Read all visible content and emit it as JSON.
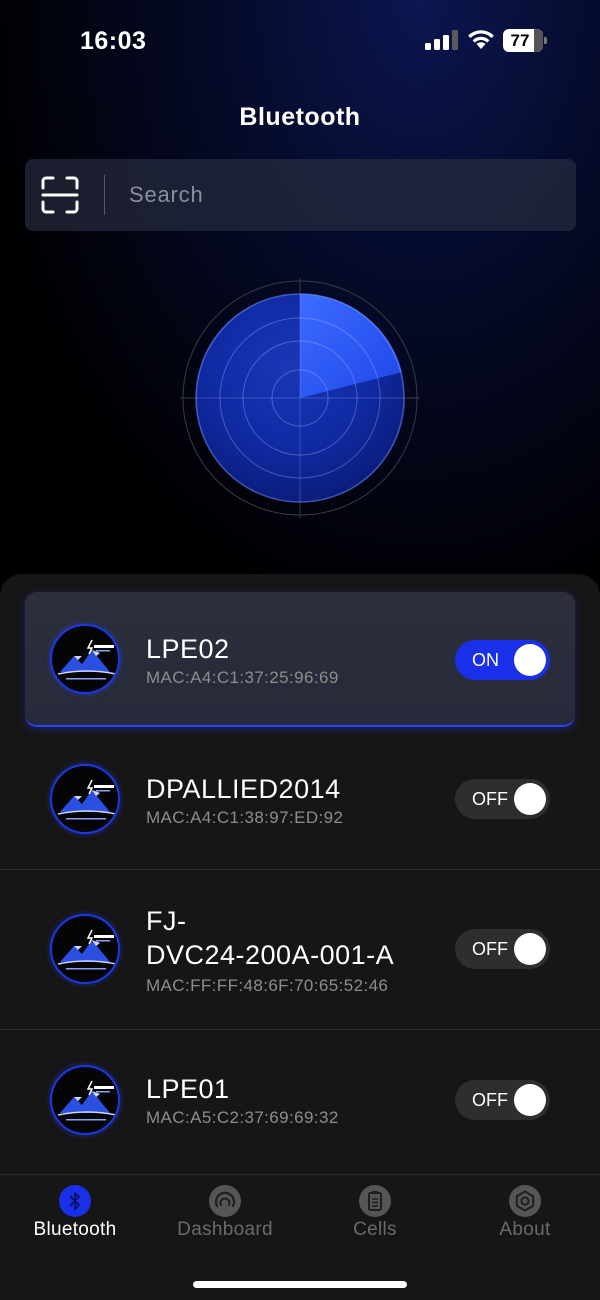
{
  "status_bar": {
    "time": "16:03",
    "battery_level": "77"
  },
  "header": {
    "title": "Bluetooth"
  },
  "search": {
    "placeholder": "Search"
  },
  "devices": [
    {
      "name": "LPE02",
      "mac": "MAC:A4:C1:37:25:96:69",
      "toggle_label": "ON",
      "connected": true
    },
    {
      "name": "DPALLIED2014",
      "mac": "MAC:A4:C1:38:97:ED:92",
      "toggle_label": "OFF",
      "connected": false
    },
    {
      "name_line1": "FJ-",
      "name_line2": "DVC24-200A-001-A",
      "mac": "MAC:FF:FF:48:6F:70:65:52:46",
      "toggle_label": "OFF",
      "connected": false
    },
    {
      "name": "LPE01",
      "mac": "MAC:A5:C2:37:69:69:32",
      "toggle_label": "OFF",
      "connected": false
    }
  ],
  "tabs": [
    {
      "label": "Bluetooth",
      "icon": "bluetooth-icon",
      "active": true
    },
    {
      "label": "Dashboard",
      "icon": "gauge-icon",
      "active": false
    },
    {
      "label": "Cells",
      "icon": "battery-cells-icon",
      "active": false
    },
    {
      "label": "About",
      "icon": "hex-settings-icon",
      "active": false
    }
  ],
  "colors": {
    "accent": "#1a2fe8",
    "background": "#000000",
    "sheet": "#161616",
    "muted_text": "#8d8d8d"
  }
}
